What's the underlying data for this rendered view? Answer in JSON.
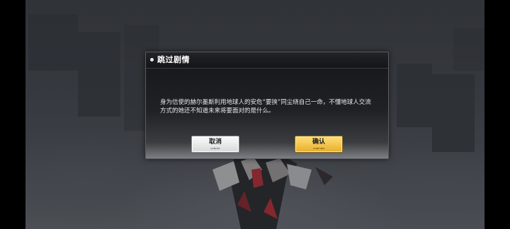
{
  "dialog": {
    "title": "跳过剧情",
    "message": "身为信使的赫尔墨斯利用地球人的安危“要挟”同尘绕自己一命，不懂地球人交流方式的她还不知道未来将要面对的是什么。",
    "cancel_label": "取消",
    "cancel_sub": "CANCEL",
    "confirm_label": "确认",
    "confirm_sub": "CONFIRM"
  },
  "colors": {
    "confirm_accent": "#f0c040",
    "cancel_bg": "#f2f2f2",
    "dialog_bg": "#1a1b1e"
  },
  "icons": {
    "header_marker": "bullet-dot-icon"
  }
}
